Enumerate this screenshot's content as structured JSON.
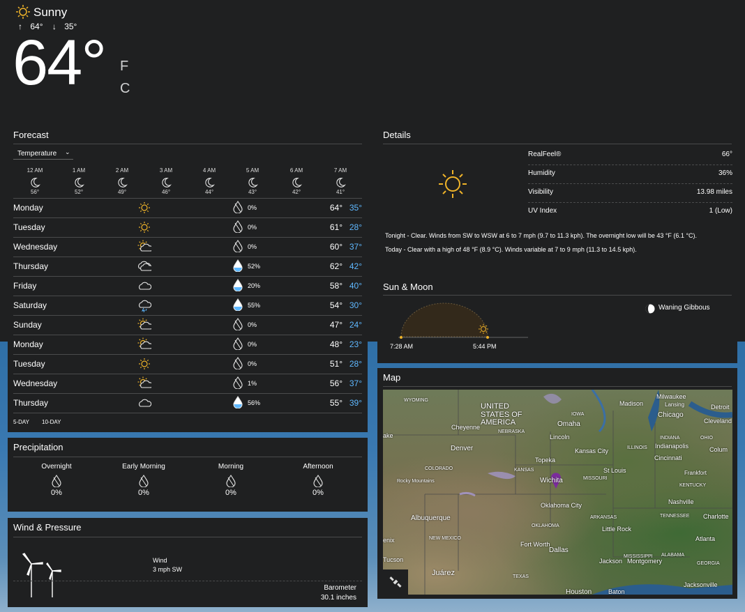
{
  "header": {
    "condition": "Sunny",
    "high": "64°",
    "low": "35°",
    "temp": "64°",
    "unit_f": "F",
    "unit_c": "C"
  },
  "forecast": {
    "title": "Forecast",
    "dropdown": "Temperature",
    "hours": [
      {
        "time": "12 AM",
        "temp": "56°"
      },
      {
        "time": "1 AM",
        "temp": "52°"
      },
      {
        "time": "2 AM",
        "temp": "49°"
      },
      {
        "time": "3 AM",
        "temp": "46°"
      },
      {
        "time": "4 AM",
        "temp": "44°"
      },
      {
        "time": "5 AM",
        "temp": "43°"
      },
      {
        "time": "6 AM",
        "temp": "42°"
      },
      {
        "time": "7 AM",
        "temp": "41°"
      }
    ],
    "days": [
      {
        "day": "Monday",
        "icon": "sun-icon",
        "precip": "0%",
        "hi": "64°",
        "lo": "35°"
      },
      {
        "day": "Tuesday",
        "icon": "sun-icon",
        "precip": "0%",
        "hi": "61°",
        "lo": "28°"
      },
      {
        "day": "Wednesday",
        "icon": "partly-sunny-icon",
        "precip": "0%",
        "hi": "60°",
        "lo": "37°"
      },
      {
        "day": "Thursday",
        "icon": "cloudy-icon",
        "precip": "52%",
        "hi": "62°",
        "lo": "42°"
      },
      {
        "day": "Friday",
        "icon": "cloud-icon",
        "precip": "20%",
        "hi": "58°",
        "lo": "40°"
      },
      {
        "day": "Saturday",
        "icon": "thunder-rain-icon",
        "precip": "55%",
        "hi": "54°",
        "lo": "30°"
      },
      {
        "day": "Sunday",
        "icon": "partly-sunny-icon",
        "precip": "0%",
        "hi": "47°",
        "lo": "24°"
      },
      {
        "day": "Monday",
        "icon": "partly-sunny-icon",
        "precip": "0%",
        "hi": "48°",
        "lo": "23°"
      },
      {
        "day": "Tuesday",
        "icon": "sun-icon",
        "precip": "0%",
        "hi": "51°",
        "lo": "28°"
      },
      {
        "day": "Wednesday",
        "icon": "partly-sunny-icon",
        "precip": "1%",
        "hi": "56°",
        "lo": "37°"
      },
      {
        "day": "Thursday",
        "icon": "cloud-icon",
        "precip": "56%",
        "hi": "55°",
        "lo": "39°"
      }
    ],
    "range_5": "5-DAY",
    "range_10": "10-DAY"
  },
  "details": {
    "title": "Details",
    "rows": [
      {
        "label": "RealFeel®",
        "value": "66°"
      },
      {
        "label": "Humidity",
        "value": "36%"
      },
      {
        "label": "Visibility",
        "value": "13.98 miles"
      },
      {
        "label": "UV Index",
        "value": "1 (Low)"
      }
    ],
    "tonight": "Tonight - Clear. Winds from SW to WSW at 6 to 7 mph (9.7 to 11.3 kph). The overnight low will be 43 °F (6.1 °C).",
    "today": "Today - Clear with a high of 48 °F (8.9 °C). Winds variable at 7 to 9 mph (11.3 to 14.5 kph)."
  },
  "sunmoon": {
    "title": "Sun & Moon",
    "sunrise": "7:28 AM",
    "sunset": "5:44 PM",
    "moon": "Waning Gibbous"
  },
  "precipitation": {
    "title": "Precipitation",
    "periods": [
      {
        "label": "Overnight",
        "value": "0%"
      },
      {
        "label": "Early Morning",
        "value": "0%"
      },
      {
        "label": "Morning",
        "value": "0%"
      },
      {
        "label": "Afternoon",
        "value": "0%"
      }
    ]
  },
  "wind": {
    "title": "Wind & Pressure",
    "wind_label": "Wind",
    "wind_value": "3 mph SW",
    "baro_label": "Barometer",
    "baro_value": "30.1 inches"
  },
  "map": {
    "title": "Map",
    "labels": [
      "UNITED STATES OF AMERICA",
      "WYOMING",
      "IOWA",
      "Milwaukee",
      "Lansing",
      "Madison",
      "Chicago",
      "Detroit",
      "Cleveland",
      "Omaha",
      "Cheyenne",
      "NEBRASKA",
      "Lincoln",
      "Denver",
      "Kansas City",
      "Topeka",
      "ILLINOIS",
      "INDIANA",
      "Indianapolis",
      "OHIO",
      "Colum",
      "Cincinnati",
      "COLORADO",
      "Rocky Mountains",
      "KANSAS",
      "St Louis",
      "MISSOURI",
      "Frankfort",
      "Wichita",
      "KENTUCKY",
      "Nashville",
      "Oklahoma City",
      "OKLAHOMA",
      "ARKANSAS",
      "Little Rock",
      "TENNESSEE",
      "Charlotte",
      "Albuquerque",
      "NEW MEXICO",
      "Atlanta",
      "Fort Worth",
      "Dallas",
      "Jackson",
      "MISSISSIPPI",
      "ALABAMA",
      "Montgomery",
      "GEORGIA",
      "Tucson",
      "Juárez",
      "TEXAS",
      "Houston",
      "Baton",
      "Jacksonville",
      "enix",
      "ake"
    ]
  },
  "colors": {
    "accent": "#5fb8ff",
    "sun": "#f0b429",
    "panel": "#1f2021"
  }
}
